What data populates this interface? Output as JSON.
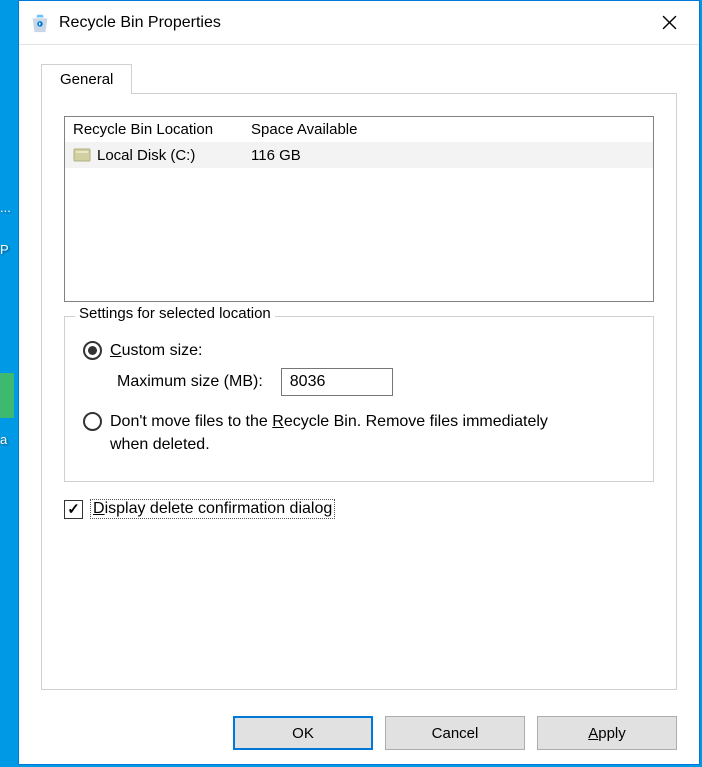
{
  "titlebar": {
    "title": "Recycle Bin Properties"
  },
  "tabs": {
    "general": "General"
  },
  "locations": {
    "header_location": "Recycle Bin Location",
    "header_space": "Space Available",
    "rows": [
      {
        "name": "Local Disk (C:)",
        "space": "116 GB"
      }
    ]
  },
  "settings": {
    "group_title": "Settings for selected location",
    "custom_size_label_pre": "C",
    "custom_size_label_post": "ustom size:",
    "max_label": "Maximum size (MB):",
    "max_value": "8036",
    "dont_move_pre": "Don't move files to the ",
    "dont_move_u": "R",
    "dont_move_post": "ecycle Bin. Remove files immediately when deleted."
  },
  "confirm": {
    "pre": "D",
    "post": "isplay delete confirmation dialog"
  },
  "buttons": {
    "ok": "OK",
    "cancel": "Cancel",
    "apply_pre": "A",
    "apply_post": "pply"
  }
}
